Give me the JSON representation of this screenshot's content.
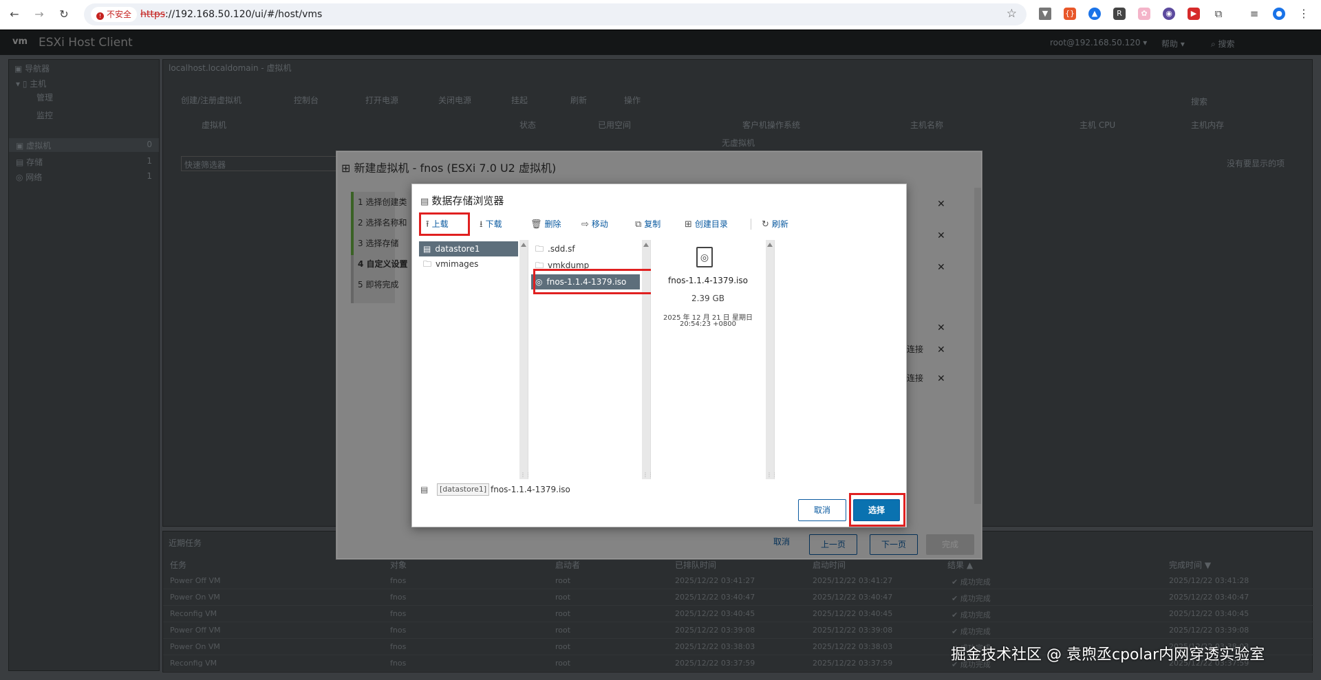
{
  "browser": {
    "security_label": "不安全",
    "url_scheme": "https",
    "url_rest": "://192.168.50.120/ui/#/host/vms",
    "back_icon": "back-arrow-icon",
    "forward_icon": "forward-arrow-icon",
    "reload_icon": "reload-icon"
  },
  "app": {
    "logo": "vm",
    "title": "ESXi Host Client",
    "user": "root@192.168.50.120 ▾",
    "help": "帮助 ▾",
    "search": "搜索"
  },
  "navigator": {
    "title": "导航器",
    "host": "主机",
    "manage": "管理",
    "monitor": "监控",
    "vms": "虚拟机",
    "vms_count": "0",
    "storage": "存储",
    "storage_count": "1",
    "network": "网络",
    "network_count": "1"
  },
  "main": {
    "breadcrumb": "localhost.localdomain - 虚拟机",
    "create_vm": "创建/注册虚拟机",
    "console": "控制台",
    "power_on": "打开电源",
    "power_off": "关闭电源",
    "suspend": "挂起",
    "refresh": "刷新",
    "actions": "操作",
    "search": "搜索",
    "columns": [
      "虚拟机",
      "状态",
      "已用空间",
      "客户机操作系统",
      "主机名称",
      "主机 CPU",
      "主机内存"
    ],
    "empty": "无虚拟机",
    "quick_filter": "快速筛选器",
    "no_items": "没有要显示的项"
  },
  "wizard": {
    "title": "新建虚拟机 - fnos (ESXi 7.0 U2 虚拟机)",
    "steps": [
      "1 选择创建类",
      "2 选择名称和",
      "3 选择存储",
      "4 自定义设置",
      "5 即将完成"
    ],
    "connect1": "连接",
    "connect2": "连接",
    "cancel": "取消",
    "prev": "上一页",
    "next": "下一页",
    "finish": "完成"
  },
  "datastore_browser": {
    "title": "数据存储浏览器",
    "toolbar": {
      "upload": "上载",
      "download": "下载",
      "delete": "删除",
      "move": "移动",
      "copy": "复制",
      "mkdir": "创建目录",
      "refresh": "刷新"
    },
    "col1": [
      "datastore1",
      "vmimages"
    ],
    "col2": [
      ".sdd.sf",
      "vmkdump",
      "fnos-1.1.4-1379.iso"
    ],
    "preview": {
      "name": "fnos-1.1.4-1379.iso",
      "size": "2.39 GB",
      "date_line1": "2025 年 12 月 21 日 星期日",
      "date_line2": "20:54:23 +0800"
    },
    "path_prefix": "[datastore1]",
    "path_file": "fnos-1.1.4-1379.iso",
    "cancel": "取消",
    "select": "选择"
  },
  "tasks": {
    "title": "近期任务",
    "columns": [
      "任务",
      "对象",
      "启动者",
      "已排队时间",
      "启动时间",
      "结果 ▲",
      "完成时间 ▼"
    ],
    "rows": [
      {
        "task": "Power Off VM",
        "obj": "fnos",
        "by": "root",
        "queued": "2025/12/22 03:41:27",
        "start": "2025/12/22 03:41:27",
        "result": "成功完成",
        "done": "2025/12/22 03:41:28"
      },
      {
        "task": "Power On VM",
        "obj": "fnos",
        "by": "root",
        "queued": "2025/12/22 03:40:47",
        "start": "2025/12/22 03:40:47",
        "result": "成功完成",
        "done": "2025/12/22 03:40:47"
      },
      {
        "task": "Reconfig VM",
        "obj": "fnos",
        "by": "root",
        "queued": "2025/12/22 03:40:45",
        "start": "2025/12/22 03:40:45",
        "result": "成功完成",
        "done": "2025/12/22 03:40:45"
      },
      {
        "task": "Power Off VM",
        "obj": "fnos",
        "by": "root",
        "queued": "2025/12/22 03:39:08",
        "start": "2025/12/22 03:39:08",
        "result": "成功完成",
        "done": "2025/12/22 03:39:08"
      },
      {
        "task": "Power On VM",
        "obj": "fnos",
        "by": "root",
        "queued": "2025/12/22 03:38:03",
        "start": "2025/12/22 03:38:03",
        "result": "成功完成",
        "done": "2025/12/22 03:38:03"
      },
      {
        "task": "Reconfig VM",
        "obj": "fnos",
        "by": "root",
        "queued": "2025/12/22 03:37:59",
        "start": "2025/12/22 03:37:59",
        "result": "成功完成",
        "done": "2025/12/22 03:37:59"
      }
    ]
  },
  "watermark": "掘金技术社区 @ 袁煦丞cpolar内网穿透实验室"
}
